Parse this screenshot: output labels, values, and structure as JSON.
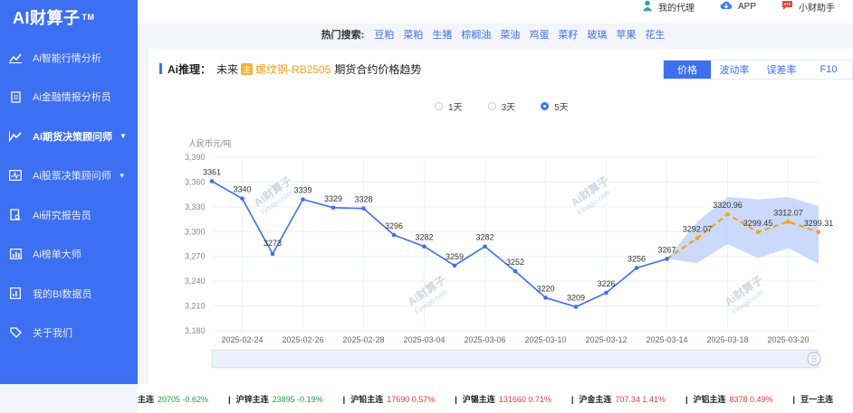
{
  "app": {
    "logo": "AI财算子",
    "tm": "TM"
  },
  "sidebar": {
    "items": [
      {
        "label": "Ai智能行情分析"
      },
      {
        "label": "Ai金融情报分析员"
      },
      {
        "label": "Ai期货决策顾问师"
      },
      {
        "label": "Ai股票决策顾问师"
      },
      {
        "label": "Ai研究报告员"
      },
      {
        "label": "Ai榜单大师"
      },
      {
        "label": "我的BI数据员"
      },
      {
        "label": "关于我们"
      }
    ]
  },
  "topbar": {
    "links": [
      {
        "label": "我的代理"
      },
      {
        "label": "APP"
      },
      {
        "label": "小财助手"
      }
    ]
  },
  "hot_search": {
    "label": "热门搜索:",
    "items": [
      "豆粕",
      "菜粕",
      "生猪",
      "棕榈油",
      "菜油",
      "鸡蛋",
      "菜籽",
      "玻璃",
      "苹果",
      "花生"
    ]
  },
  "card": {
    "prefix": "Ai推理：",
    "prefix2": "未来",
    "mark": "主",
    "contract": "螺纹钢-RB2505",
    "suffix": "期货合约价格趋势",
    "tabs": [
      "价格",
      "波动率",
      "误差率",
      "F10"
    ],
    "radios": [
      "1天",
      "3天",
      "5天"
    ],
    "watermark": "Ai财算子",
    "watermark_url": "Finago.com"
  },
  "chart_data": {
    "type": "line",
    "ylabel": "人民币元/吨",
    "ylim": [
      3180,
      3390
    ],
    "yticks": [
      "3,390",
      "3,360",
      "3,330",
      "3,300",
      "3,270",
      "3,240",
      "3,210",
      "3,180"
    ],
    "xticks": [
      "2025-02-24",
      "2025-02-26",
      "2025-02-28",
      "2025-03-04",
      "2025-03-06",
      "2025-03-10",
      "2025-03-12",
      "2025-03-14",
      "2025-03-18",
      "2025-03-20"
    ],
    "series": [
      {
        "values": [
          3361,
          3340,
          3273,
          3339,
          3329,
          3328,
          3296,
          3282,
          3259,
          3282,
          3252,
          3220,
          3209,
          3226,
          3256,
          3267
        ]
      },
      {
        "values": [
          3267,
          3292.07,
          3320.96,
          3299.45,
          3312.07,
          3299.31
        ]
      }
    ],
    "data_labels": [
      "3361",
      "3340",
      "3273",
      "3339",
      "3329",
      "3328",
      "3296",
      "3282",
      "3259",
      "3282",
      "3252",
      "3220",
      "3209",
      "3226",
      "3256",
      "3267",
      "3292.07",
      "3320.96",
      "3299.45",
      "3312.07",
      "3299.31"
    ],
    "band_upper": [
      3267,
      3312,
      3342,
      3339,
      3342,
      3331
    ],
    "band_lower": [
      3267,
      3262,
      3285,
      3268,
      3280,
      3261
    ],
    "colors": {
      "actual": "#3d6ff2",
      "forecast": "#f3a11c",
      "band": "#b9cdfa"
    }
  },
  "ticker": [
    {
      "name": "主连",
      "price": "20705",
      "chg": "-0.62%",
      "dir": "down"
    },
    {
      "name": "沪锌主连",
      "price": "23895",
      "chg": "-0.19%",
      "dir": "down"
    },
    {
      "name": "沪铅主连",
      "price": "17690",
      "chg": "0.57%",
      "dir": "up"
    },
    {
      "name": "沪锡主连",
      "price": "131660",
      "chg": "0.71%",
      "dir": "up"
    },
    {
      "name": "沪金主连",
      "price": "707.34",
      "chg": "1.41%",
      "dir": "up"
    },
    {
      "name": "沪铝主连",
      "price": "8378",
      "chg": "0.49%",
      "dir": "up"
    },
    {
      "name": "豆一主连",
      "price": "",
      "chg": "",
      "dir": "up"
    }
  ]
}
